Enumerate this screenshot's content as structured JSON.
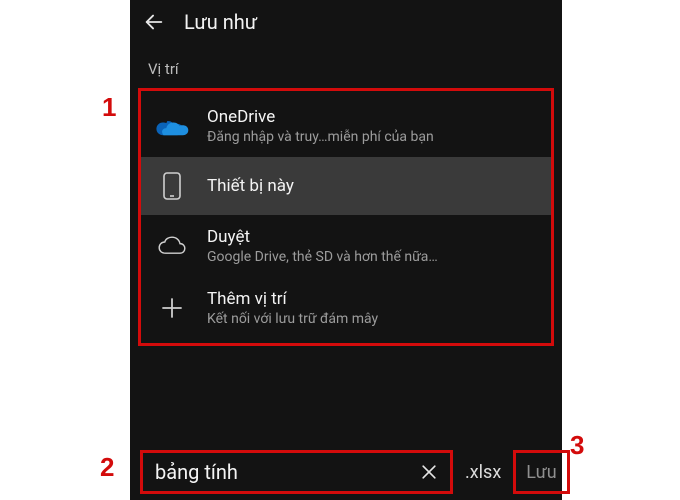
{
  "header": {
    "title": "Lưu như"
  },
  "section_label": "Vị trí",
  "locations": [
    {
      "id": "onedrive",
      "name": "OneDrive",
      "sub": "Đăng nhập và truy…miễn phí của bạn",
      "icon": "onedrive-cloud-icon",
      "selected": false
    },
    {
      "id": "this-device",
      "name": "Thiết bị này",
      "sub": "",
      "icon": "phone-icon",
      "selected": true
    },
    {
      "id": "browse",
      "name": "Duyệt",
      "sub": "Google Drive, thẻ SD và hơn thế nữa…",
      "icon": "cloud-outline-icon",
      "selected": false
    },
    {
      "id": "add-place",
      "name": "Thêm vị trí",
      "sub": "Kết nối với lưu trữ đám mây",
      "icon": "plus-icon",
      "selected": false
    }
  ],
  "bottom": {
    "filename_value": "bảng tính",
    "extension": ".xlsx",
    "save_label": "Lưu"
  },
  "annotations": {
    "n1": "1",
    "n2": "2",
    "n3": "3"
  },
  "colors": {
    "highlight": "#d30b0b",
    "bg": "#131313",
    "selected_bg": "#3a3a3a"
  }
}
